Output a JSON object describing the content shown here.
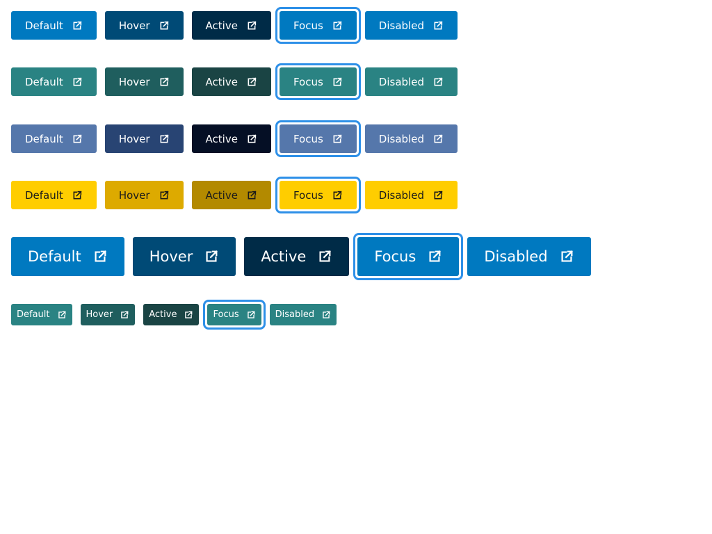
{
  "rows": [
    {
      "variant": "primary",
      "buttons": [
        {
          "label": "Default",
          "bg": "#0079c0"
        },
        {
          "label": "Hover",
          "bg": "#004a76"
        },
        {
          "label": "Active",
          "bg": "#002b47"
        },
        {
          "label": "Focus",
          "bg": "#0079c0"
        },
        {
          "label": "Disabled",
          "bg": "#0079c0"
        }
      ]
    },
    {
      "variant": "teal",
      "buttons": [
        {
          "label": "Default",
          "bg": "#2a8383"
        },
        {
          "label": "Hover",
          "bg": "#1f5e5e"
        },
        {
          "label": "Active",
          "bg": "#1a4444"
        },
        {
          "label": "Focus",
          "bg": "#2a8383"
        },
        {
          "label": "Disabled",
          "bg": "#2a8383"
        }
      ]
    },
    {
      "variant": "slate",
      "buttons": [
        {
          "label": "Default",
          "bg": "#5577ab"
        },
        {
          "label": "Hover",
          "bg": "#284473"
        },
        {
          "label": "Active",
          "bg": "#050f25"
        },
        {
          "label": "Focus",
          "bg": "#5577ab"
        },
        {
          "label": "Disabled",
          "bg": "#5577ab"
        }
      ]
    },
    {
      "variant": "yellow",
      "buttons": [
        {
          "label": "Default",
          "bg": "#ffcd00"
        },
        {
          "label": "Hover",
          "bg": "#ddaa00"
        },
        {
          "label": "Active",
          "bg": "#b38a00"
        },
        {
          "label": "Focus",
          "bg": "#ffcd00"
        },
        {
          "label": "Disabled",
          "bg": "#ffcd00"
        }
      ]
    },
    {
      "variant": "primary-large",
      "buttons": [
        {
          "label": "Default",
          "bg": "#0079c0"
        },
        {
          "label": "Hover",
          "bg": "#004a76"
        },
        {
          "label": "Active",
          "bg": "#002b47"
        },
        {
          "label": "Focus",
          "bg": "#0079c0"
        },
        {
          "label": "Disabled",
          "bg": "#0079c0"
        }
      ]
    },
    {
      "variant": "teal-small",
      "buttons": [
        {
          "label": "Default",
          "bg": "#2a8383"
        },
        {
          "label": "Hover",
          "bg": "#1f5e5e"
        },
        {
          "label": "Active",
          "bg": "#1a4444"
        },
        {
          "label": "Focus",
          "bg": "#2a8383"
        },
        {
          "label": "Disabled",
          "bg": "#2a8383"
        }
      ]
    }
  ],
  "icon": "external-link-icon",
  "focus_ring_color": "#2e90e8"
}
